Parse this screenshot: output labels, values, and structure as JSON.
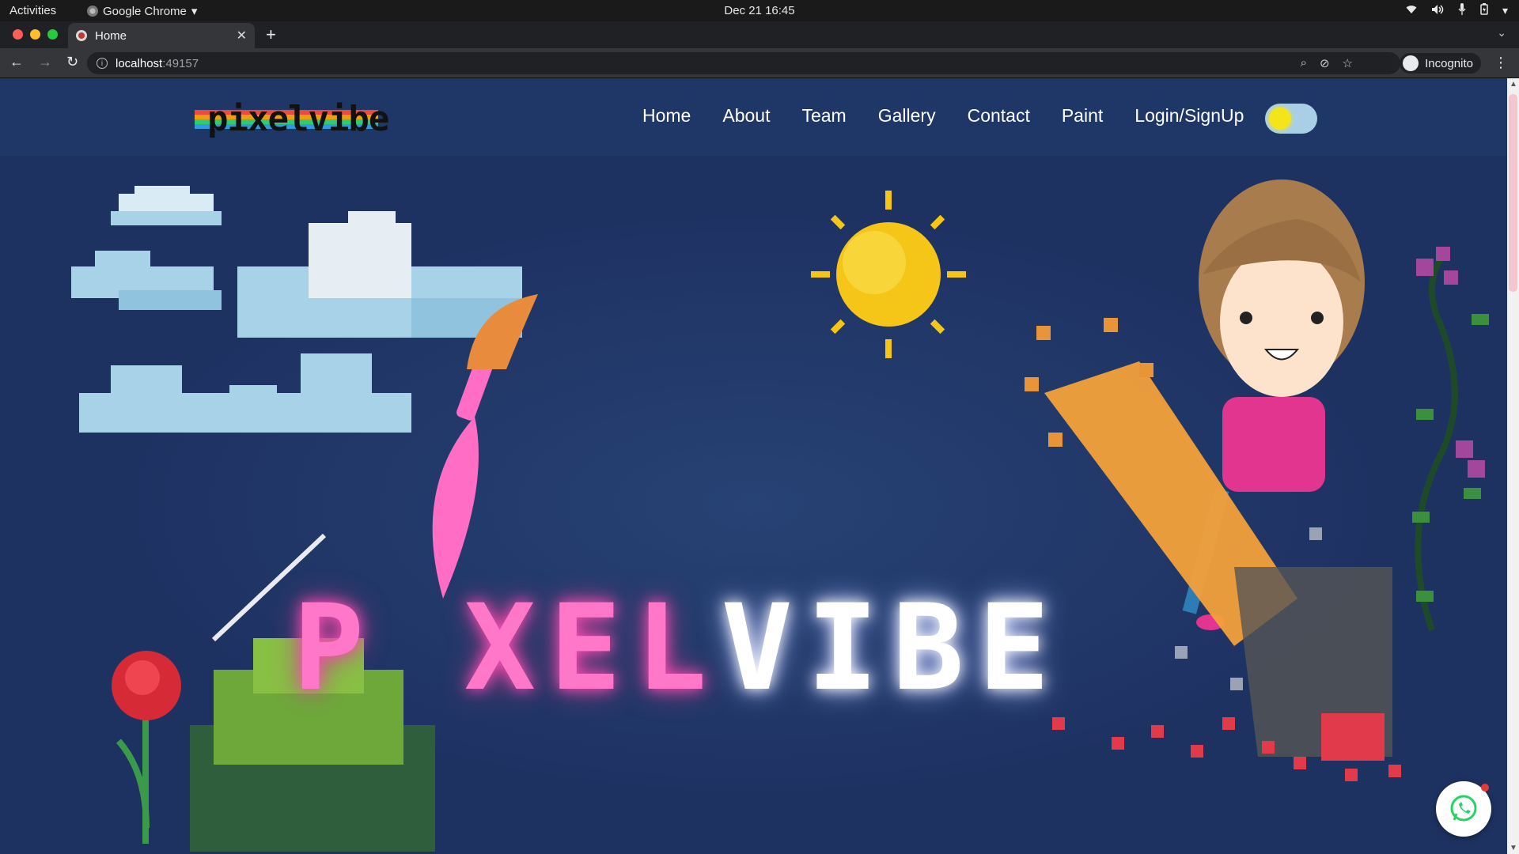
{
  "os": {
    "activities": "Activities",
    "app_name": "Google Chrome",
    "clock": "Dec 21  16:45"
  },
  "browser": {
    "tab_title": "Home",
    "url_host": "localhost",
    "url_port": ":49157",
    "profile": "Incognito"
  },
  "site": {
    "logo_text": "pixelvibe",
    "nav": [
      "Home",
      "About",
      "Team",
      "Gallery",
      "Contact",
      "Paint",
      "Login/SignUp"
    ],
    "hero_title_pink": "P XEL",
    "hero_title_white": "VIBE"
  },
  "colors": {
    "page_bg": "#1e3262",
    "header_bg": "#1f3766",
    "accent_pink": "#ff77c8",
    "toggle_track": "#a9cfe6",
    "toggle_knob": "#f4e51a",
    "whatsapp_green": "#25d366"
  }
}
